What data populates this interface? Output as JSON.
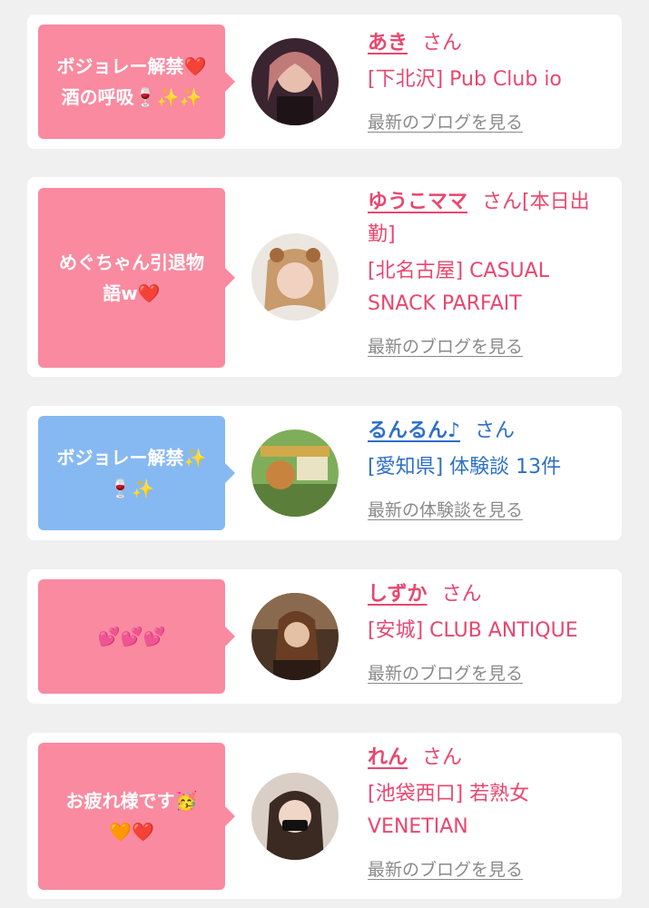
{
  "colors": {
    "pink": "#f98aa0",
    "blue": "#86b9f2",
    "name_pink": "#e8476f",
    "name_blue": "#2e6fc7"
  },
  "cards": [
    {
      "bubble": "ボジョレー解禁❤️\n酒の呼吸🍷✨✨",
      "bubble_color": "pink",
      "name": "あき",
      "suffix": "さん",
      "shop": "[下北沢] Pub Club io",
      "link": "最新のブログを見る"
    },
    {
      "bubble": "めぐちゃん引退物\n語w❤️",
      "bubble_color": "pink",
      "name": "ゆうこママ",
      "suffix": "さん[本日出勤]",
      "shop": "[北名古屋] CASUAL SNACK PARFAIT",
      "link": "最新のブログを見る"
    },
    {
      "bubble": "ボジョレー解禁✨\n🍷✨",
      "bubble_color": "blue",
      "name": "るんるん♪",
      "suffix": "さん",
      "shop": "[愛知県] 体験談 13件",
      "link": "最新の体験談を見る"
    },
    {
      "bubble": "💕💕💕",
      "bubble_color": "pink",
      "name": "しずか",
      "suffix": "さん",
      "shop": "[安城] CLUB ANTIQUE",
      "link": "最新のブログを見る"
    },
    {
      "bubble": "お疲れ様です🥳\n🧡❤️",
      "bubble_color": "pink",
      "name": "れん",
      "suffix": "さん",
      "shop": "[池袋西口] 若熟女 VENETIAN",
      "link": "最新のブログを見る"
    }
  ]
}
